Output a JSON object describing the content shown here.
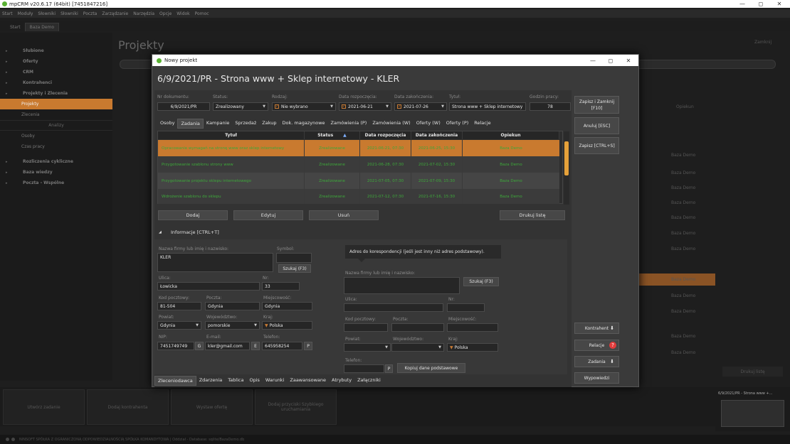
{
  "app": {
    "title": "mpCRM v20.6.17 (64bit) [7451847216]",
    "menu": [
      "Start",
      "Moduły",
      "Słowniki",
      "Słowniki",
      "Poczta",
      "Zarządzanie",
      "Narzędzia",
      "Opcje",
      "Widok",
      "Pomoc"
    ],
    "tabs": [
      "Start",
      "Baza Demo"
    ],
    "window_controls": [
      "—",
      "◻",
      "✕"
    ]
  },
  "sidebar": {
    "items": [
      {
        "label": "Słubione",
        "arrow": "▸"
      },
      {
        "label": "Oferty",
        "arrow": "▸"
      },
      {
        "label": "CRM",
        "arrow": "▸"
      },
      {
        "label": "Kontrahenci",
        "arrow": "▸"
      },
      {
        "label": "Projekty i Zlecenia",
        "arrow": "▸"
      }
    ],
    "sub_items": [
      "Projekty",
      "Zlecenia"
    ],
    "section": "Analizy",
    "sub_items2": [
      "Osoby",
      "Czas pracy"
    ],
    "items2": [
      {
        "label": "Rozliczenia cykliczne",
        "arrow": "▸"
      },
      {
        "label": "Baza wiedzy",
        "arrow": "▸"
      },
      {
        "label": "Poczta - Wspólne",
        "arrow": "▸"
      }
    ]
  },
  "background": {
    "title": "Projekty",
    "close_label": "Zamknij",
    "col_opiekun": "Opiekun",
    "row_values": [
      "Baza Demo",
      "Baza Demo",
      "Baza Demo",
      "Baza Demo",
      "Baza Demo",
      "Baza Demo",
      "Baza Demo",
      "Baza Demo",
      "Baza Demo",
      "Baza Demo",
      "Baza Demo",
      "Baza Demo"
    ],
    "print_label": "Drukuj listę",
    "bottom_buttons": [
      "Utwórz zadanie",
      "Dodaj kontrahenta",
      "Wystaw ofertę",
      "Dodaj przyciski Szybkiego uruchamiania"
    ],
    "preview_label": "6/9/2021/PR - Strona www +...",
    "status_text": "NINSOFT SPÓŁKA Z OGRANICZONĄ ODPOWIEDZIALNOŚCIĄ SPÓŁKA KOMANDYTOWA | Oddział - Database: sqlite/BazaDemo.db"
  },
  "dialog": {
    "window_title": "Nowy projekt",
    "heading": "6/9/2021/PR - Strona www + Sklep internetowy - KLER",
    "fields": {
      "nr_label": "Nr dokumentu:",
      "nr_value": "6/9/2021/PR",
      "status_label": "Status:",
      "status_value": "Zrealizowany",
      "rodzaj_label": "Rodzaj:",
      "rodzaj_value": "Nie wybrano",
      "start_label": "Data rozpoczęcia:",
      "start_value": "2021-06-21",
      "end_label": "Data zakończenia:",
      "end_value": "2021-07-26",
      "title_label": "Tytuł:",
      "title_value": "Strona www + Sklep internetowy",
      "hours_label": "Godzin pracy:",
      "hours_value": "78"
    },
    "tabs": [
      "Osoby",
      "Zadania",
      "Kampanie",
      "Sprzedaż",
      "Zakup",
      "Dok. magazynowe",
      "Zamówienia (P)",
      "Zamówienia (W)",
      "Oferty (W)",
      "Oferty (P)",
      "Relacje"
    ],
    "active_tab": 1,
    "grid": {
      "headers": [
        "Tytuł",
        "Status",
        "Data rozpoczęcia",
        "Data zakończenia",
        "Opiekun"
      ],
      "sort_icon": "▲",
      "rows": [
        {
          "title": "Opracowanie wymagań na stronę www oraz sklep internetowy",
          "status": "Zrealizowane",
          "start": "2021-06-21, 07:30",
          "end": "2021-06-25, 15:30",
          "owner": "Baza Demo"
        },
        {
          "title": "Przygotowanie szablonu strony www",
          "status": "Zrealizowane",
          "start": "2021-06-28, 07:30",
          "end": "2021-07-02, 15:30",
          "owner": "Baza Demo"
        },
        {
          "title": "Przygotowanie projektu sklepu internetowego",
          "status": "Zrealizowane",
          "start": "2021-07-05, 07:30",
          "end": "2021-07-09, 15:30",
          "owner": "Baza Demo"
        },
        {
          "title": "Wdrożenie szablonu do sklepu",
          "status": "Zrealizowane",
          "start": "2021-07-12, 07:30",
          "end": "2021-07-16, 15:30",
          "owner": "Baza Demo"
        }
      ],
      "buttons": [
        "Dodaj",
        "Edytuj",
        "Usuń",
        "Drukuj listę"
      ]
    },
    "info": {
      "header": "Informacje [CTRL+T]",
      "name_label": "Nazwa firmy lub imię i nazwisko:",
      "name_value": "KLER",
      "symbol_label": "Symbol:",
      "search_label": "Szukaj (F3)",
      "street_label": "Ulica:",
      "street_value": "Łowicka",
      "nr_label": "Nr:",
      "nr_value": "33",
      "zip_label": "Kod pocztowy:",
      "zip_value": "81-504",
      "post_label": "Poczta:",
      "post_value": "Gdynia",
      "city_label": "Miejscowość:",
      "city_value": "Gdynia",
      "county_label": "Powiat:",
      "county_value": "Gdynia",
      "voiv_label": "Województwo:",
      "voiv_value": "pomorskie",
      "country_label": "Kraj:",
      "country_value": "Polska",
      "nip_label": "NIP:",
      "nip_value": "7451749749",
      "nip_btn": "G",
      "email_label": "E-mail:",
      "email_value": "kler@gmail.com",
      "email_btn": "E",
      "phone_label": "Telefon:",
      "phone_value": "645958254",
      "phone_btn": "P",
      "addr_hint": "Adres do korespondencji (jeśli jest inny niż adres podstawowy).",
      "c_name_label": "Nazwa firmy lub imię i nazwisko:",
      "c_search_label": "Szukaj (F3)",
      "c_street_label": "Ulica:",
      "c_nr_label": "Nr:",
      "c_zip_label": "Kod pocztowy:",
      "c_post_label": "Poczta:",
      "c_city_label": "Miejscowość:",
      "c_county_label": "Powiat:",
      "c_voiv_label": "Województwo:",
      "c_country_label": "Kraj:",
      "c_country_value": "Polska",
      "c_phone_label": "Telefon:",
      "c_phone_btn": "P",
      "copy_label": "Kopiuj dane podstawowe"
    },
    "bottom_tabs": [
      "Zleceniodawca",
      "Zdarzenia",
      "Tablica",
      "Opis",
      "Warunki",
      "Zaawansowane",
      "Atrybuty",
      "Załączniki"
    ],
    "active_bottom_tab": 0,
    "side_buttons": {
      "save_close": "Zapisz i Zamknij [F10]",
      "cancel": "Anuluj [ESC]",
      "save": "Zapisz [CTRL+S]",
      "kontrahent": "Kontrahent",
      "relacje": "Relacje",
      "relacje_badge": "?",
      "zadania": "Zadania",
      "wypowiedzi": "Wypowiedzi"
    }
  }
}
